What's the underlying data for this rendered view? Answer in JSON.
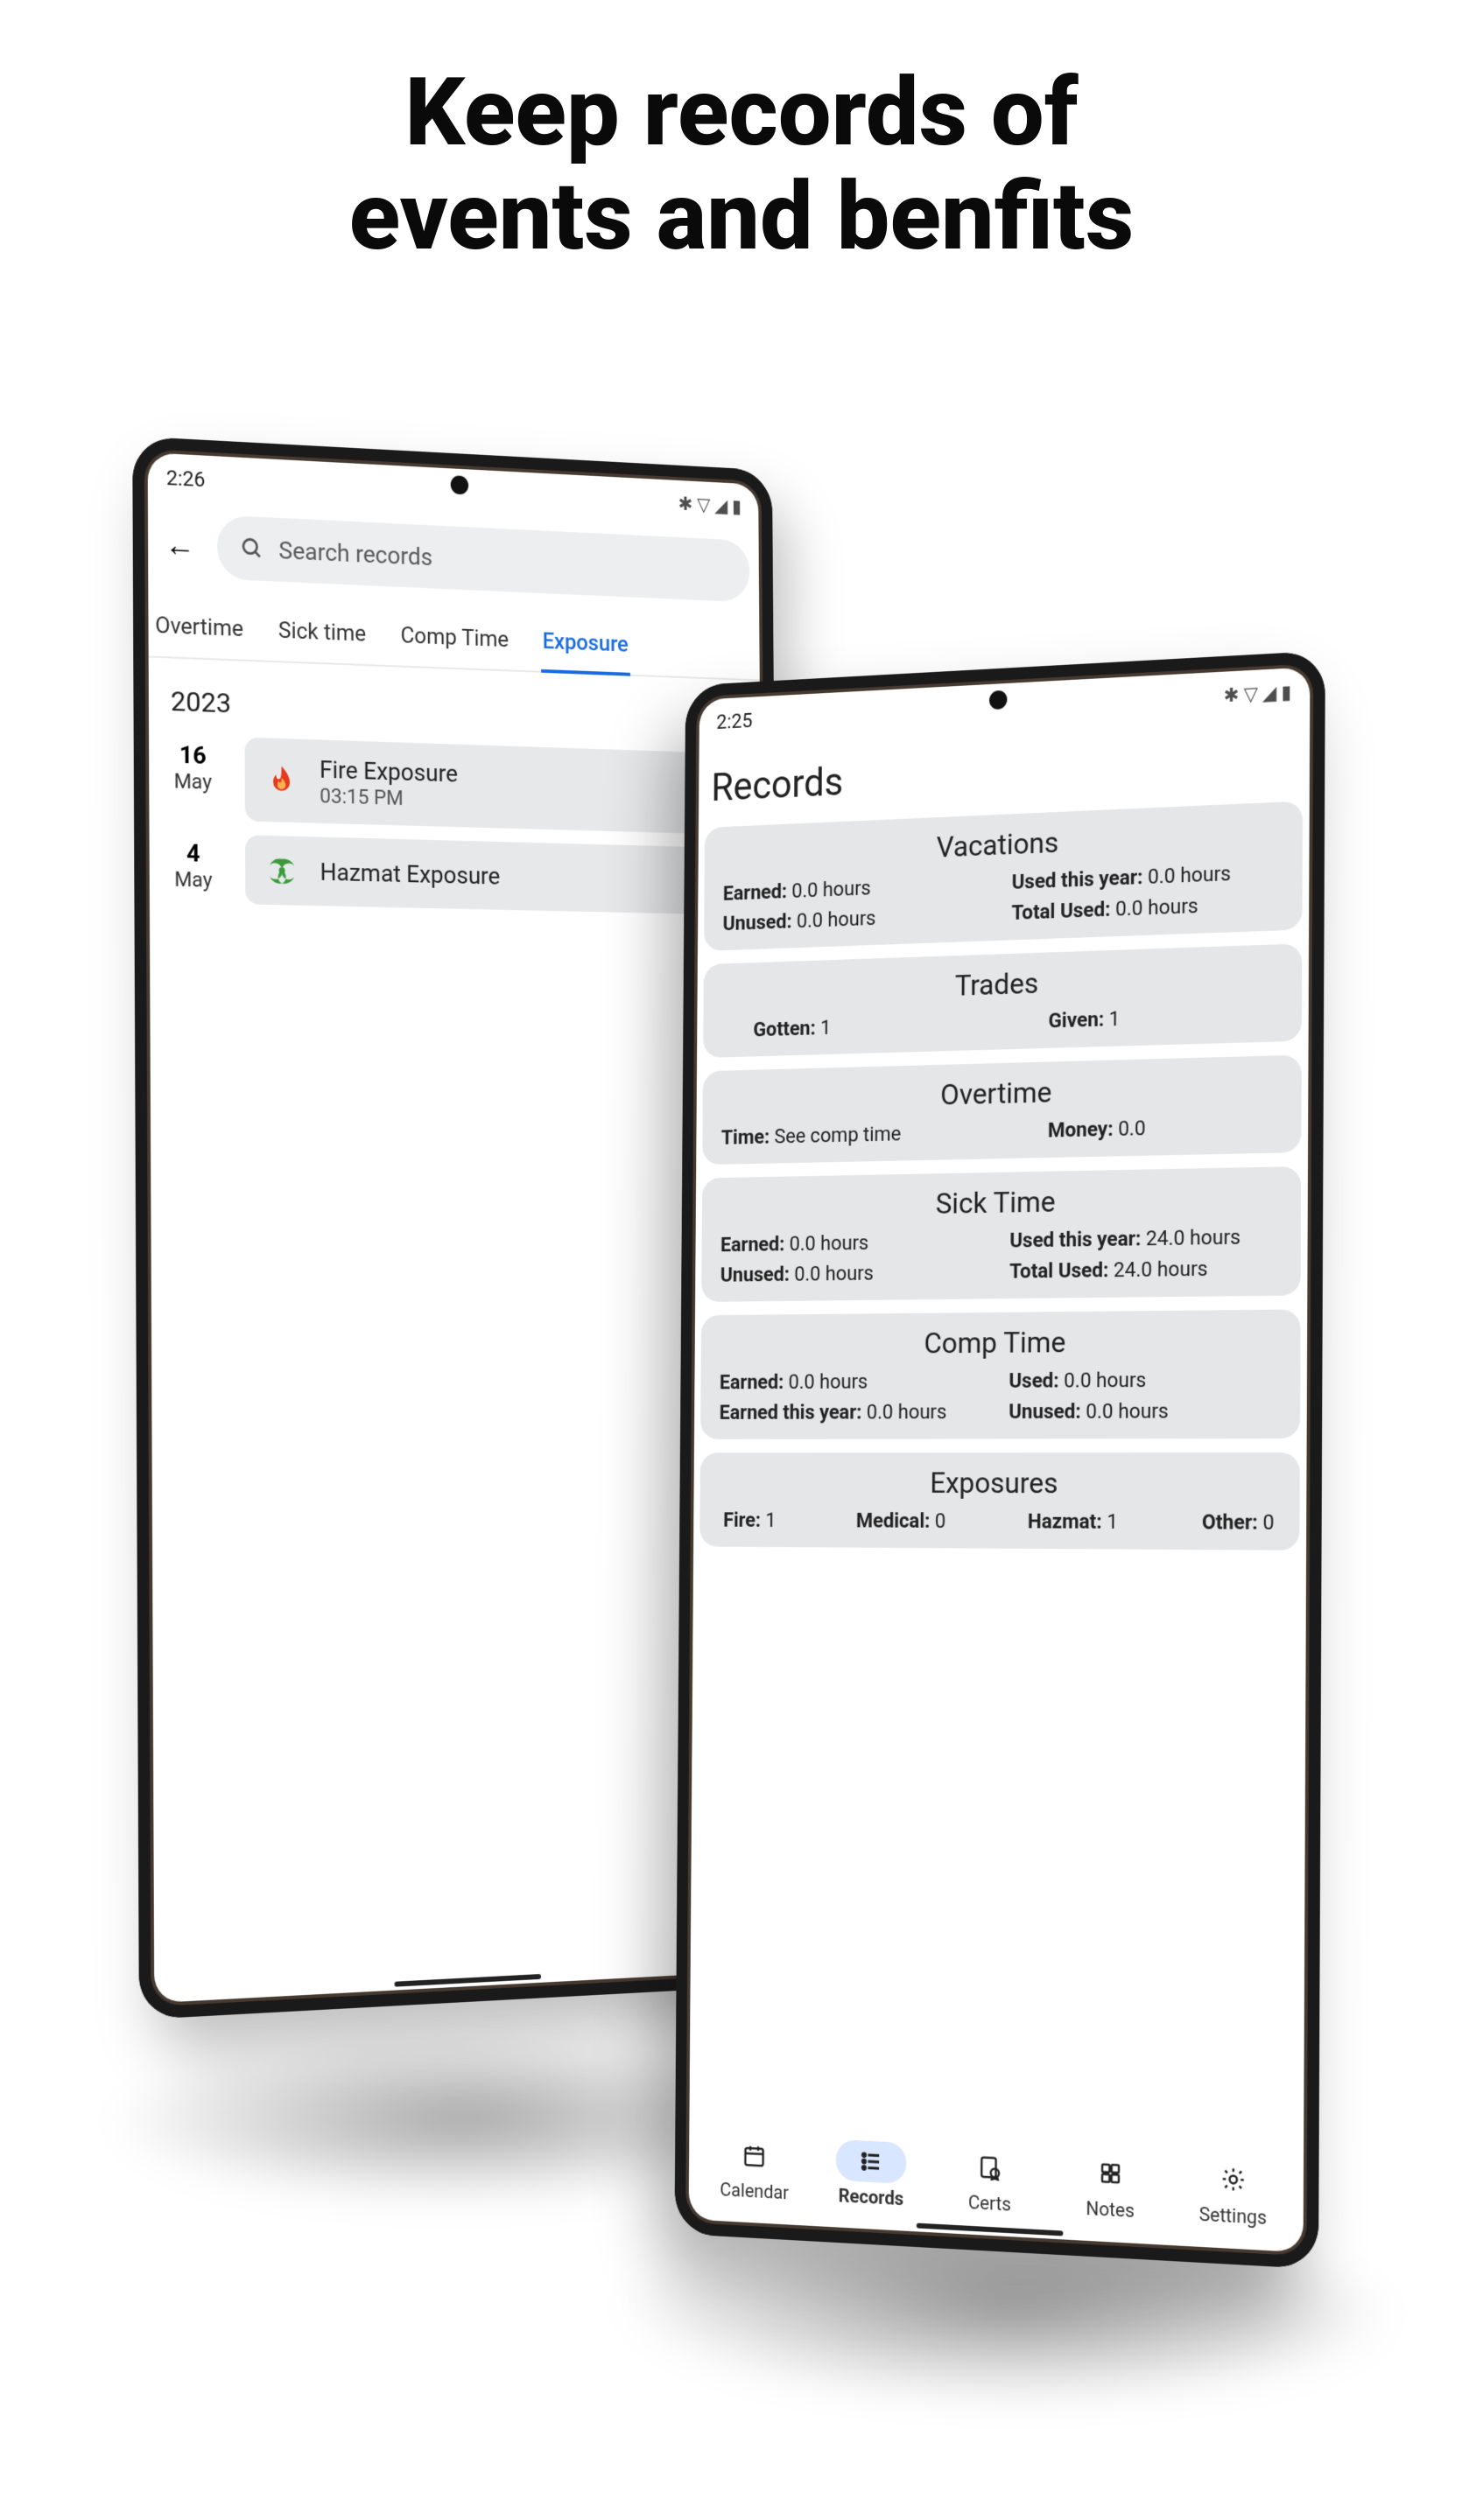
{
  "headline_line1": "Keep records of",
  "headline_line2": "events and benfits",
  "phone1": {
    "status_time": "2:26",
    "search": {
      "placeholder": "Search records"
    },
    "tabs": [
      "Overtime",
      "Sick time",
      "Comp Time",
      "Exposure"
    ],
    "active_tab_index": 3,
    "year": "2023",
    "events": [
      {
        "day": "16",
        "month": "May",
        "title": "Fire Exposure",
        "time": "03:15 PM",
        "icon": "fire"
      },
      {
        "day": "4",
        "month": "May",
        "title": "Hazmat Exposure",
        "time": "",
        "icon": "hazmat"
      }
    ]
  },
  "phone2": {
    "status_time": "2:25",
    "title": "Records",
    "cards": {
      "vacations": {
        "title": "Vacations",
        "earned_label": "Earned:",
        "earned": "0.0 hours",
        "unused_label": "Unused:",
        "unused": "0.0 hours",
        "used_year_label": "Used this year:",
        "used_year": "0.0 hours",
        "total_used_label": "Total Used:",
        "total_used": "0.0 hours"
      },
      "trades": {
        "title": "Trades",
        "gotten_label": "Gotten:",
        "gotten": "1",
        "given_label": "Given:",
        "given": "1"
      },
      "overtime": {
        "title": "Overtime",
        "time_label": "Time:",
        "time": "See comp time",
        "money_label": "Money:",
        "money": "0.0"
      },
      "sick": {
        "title": "Sick Time",
        "earned_label": "Earned:",
        "earned": "0.0 hours",
        "unused_label": "Unused:",
        "unused": "0.0 hours",
        "used_year_label": "Used this year:",
        "used_year": "24.0 hours",
        "total_used_label": "Total Used:",
        "total_used": "24.0 hours"
      },
      "comp": {
        "title": "Comp Time",
        "earned_label": "Earned:",
        "earned": "0.0 hours",
        "earned_year_label": "Earned this year:",
        "earned_year": "0.0 hours",
        "used_label": "Used:",
        "used": "0.0 hours",
        "unused_label": "Unused:",
        "unused": "0.0 hours"
      },
      "exposures": {
        "title": "Exposures",
        "fire_label": "Fire:",
        "fire": "1",
        "medical_label": "Medical:",
        "medical": "0",
        "hazmat_label": "Hazmat:",
        "hazmat": "1",
        "other_label": "Other:",
        "other": "0"
      }
    },
    "nav": {
      "items": [
        {
          "label": "Calendar",
          "icon": "calendar"
        },
        {
          "label": "Records",
          "icon": "list"
        },
        {
          "label": "Certs",
          "icon": "cert"
        },
        {
          "label": "Notes",
          "icon": "notes"
        },
        {
          "label": "Settings",
          "icon": "gear"
        }
      ],
      "active_index": 1
    }
  }
}
